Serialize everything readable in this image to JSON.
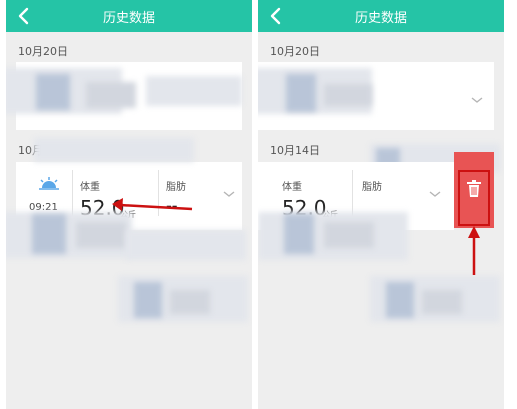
{
  "left": {
    "title": "历史数据",
    "groups": [
      {
        "date": "10月20日"
      },
      {
        "date": "10月14日",
        "record": {
          "time": "09:21",
          "weight_label": "体重",
          "weight_value": "52.0",
          "weight_unit": "公斤",
          "fat_label": "脂肪",
          "fat_value": "--"
        }
      }
    ]
  },
  "right": {
    "title": "历史数据",
    "groups": [
      {
        "date": "10月20日"
      },
      {
        "date": "10月14日",
        "record": {
          "weight_label": "体重",
          "weight_value": "52.0",
          "weight_unit": "公斤",
          "fat_label": "脂肪"
        }
      }
    ]
  },
  "colors": {
    "accent": "#25c4a6",
    "delete": "#e85454",
    "annotation": "#cc1111"
  },
  "icons": {
    "back": "chevron-left-icon",
    "expand": "chevron-down-icon",
    "time": "sunrise-icon",
    "delete": "trash-icon"
  }
}
